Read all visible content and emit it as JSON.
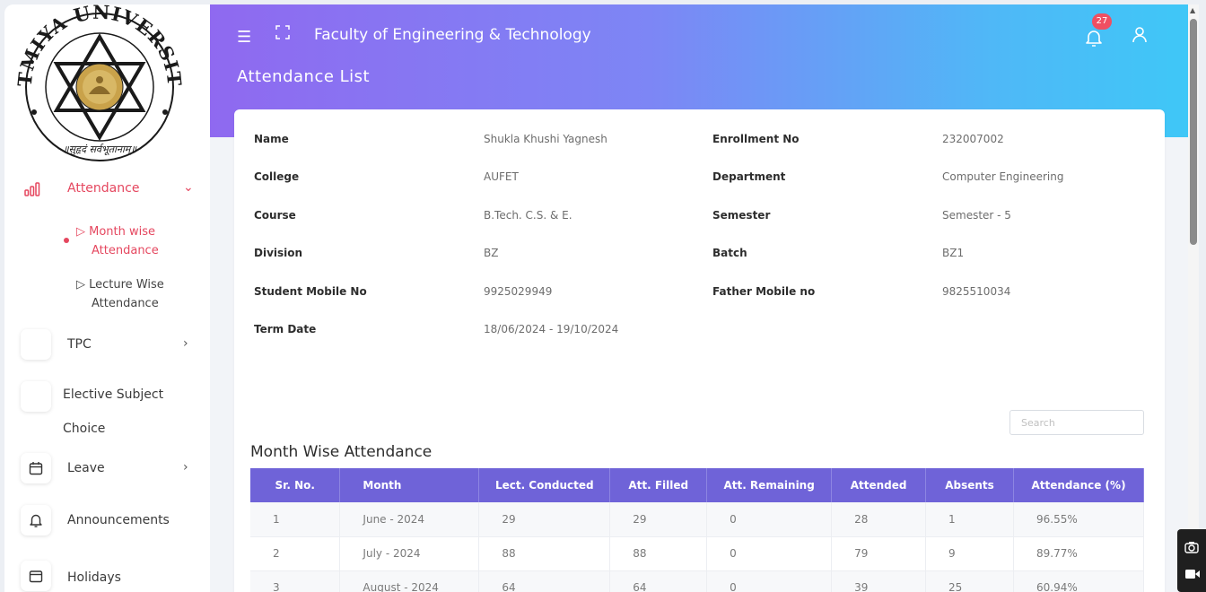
{
  "header": {
    "faculty": "Faculty of Engineering & Technology",
    "page_title": "Attendance List",
    "notification_count": "27"
  },
  "logo": {
    "ring_text_top": "ATMIYA UNIVERSITY",
    "ring_text_bottom": "॥सुहृदं सर्वभूतानाम्॥"
  },
  "sidebar": {
    "attendance": "Attendance",
    "month_wise": [
      "▷ Month wise",
      "Attendance"
    ],
    "lecture_wise": [
      "▷ Lecture Wise",
      "Attendance"
    ],
    "tpc": "TPC",
    "elective": [
      "Elective Subject",
      "Choice"
    ],
    "leave": "Leave",
    "announcements": "Announcements",
    "holidays": "Holidays"
  },
  "student": {
    "name_label": "Name",
    "name": "Shukla Khushi Yagnesh",
    "enrollment_label": "Enrollment No",
    "enrollment": "232007002",
    "college_label": "College",
    "college": "AUFET",
    "department_label": "Department",
    "department": "Computer Engineering",
    "course_label": "Course",
    "course": "B.Tech. C.S. & E.",
    "semester_label": "Semester",
    "semester": "Semester - 5",
    "division_label": "Division",
    "division": "BZ",
    "batch_label": "Batch",
    "batch": "BZ1",
    "student_mobile_label": "Student Mobile No",
    "student_mobile": "9925029949",
    "father_mobile_label": "Father Mobile no",
    "father_mobile": "9825510034",
    "term_label": "Term Date",
    "term": "18/06/2024 - 19/10/2024"
  },
  "search": {
    "placeholder": "Search"
  },
  "table": {
    "title": "Month Wise Attendance",
    "headers": [
      "Sr. No.",
      "Month",
      "Lect. Conducted",
      "Att. Filled",
      "Att. Remaining",
      "Attended",
      "Absents",
      "Attendance (%)"
    ],
    "rows": [
      [
        "1",
        "June - 2024",
        "29",
        "29",
        "0",
        "28",
        "1",
        "96.55%"
      ],
      [
        "2",
        "July - 2024",
        "88",
        "88",
        "0",
        "79",
        "9",
        "89.77%"
      ],
      [
        "3",
        "August - 2024",
        "64",
        "64",
        "0",
        "39",
        "25",
        "60.94%"
      ]
    ]
  },
  "colors": {
    "accent": "#e5475f",
    "table_header": "#6f63d8",
    "header_gradient_start": "#8f69f0",
    "header_gradient_end": "#3fc7f7"
  }
}
